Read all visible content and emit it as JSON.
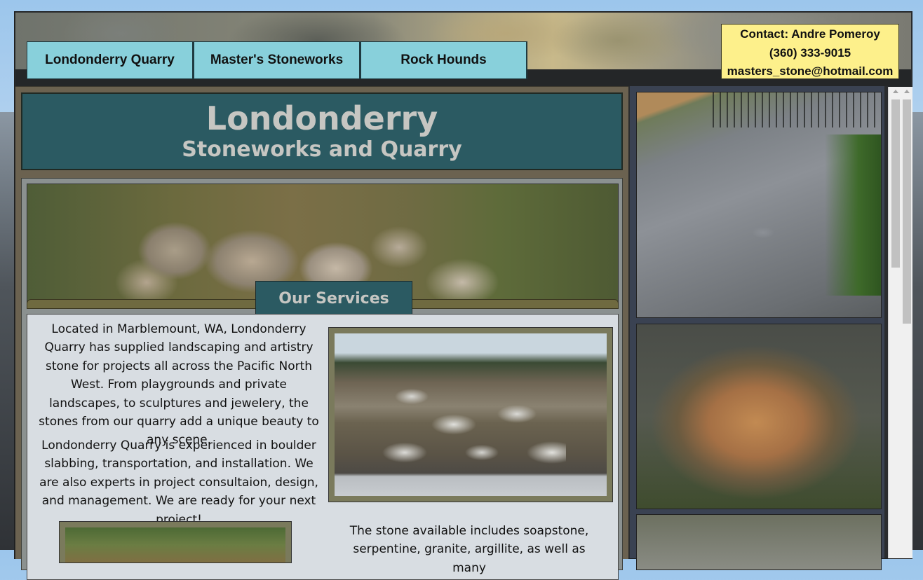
{
  "nav": {
    "items": [
      {
        "label": "Londonderry Quarry"
      },
      {
        "label": "Master's Stoneworks"
      },
      {
        "label": "Rock Hounds"
      }
    ]
  },
  "contact": {
    "line1": "Contact: Andre Pomeroy",
    "phone": "(360) 333-9015",
    "email": "masters_stone@hotmail.com"
  },
  "header": {
    "title": "Londonderry",
    "subtitle": "Stoneworks and Quarry"
  },
  "services": {
    "tab_label": "Our Services",
    "p1": "Located in Marblemount, WA, Londonderry Quarry has supplied landscaping and artistry stone for projects all across the Pacific North West. From playgrounds and private landscapes, to sculptures and jewelery, the stones from our quarry add a unique beauty to any scene.",
    "p2": "Londonderry Quarry is experienced in boulder slabbing, transportation, and installation. We are also experts in project consultaion, design, and management. We are ready for your next project!",
    "p3": "The stone available includes soapstone, serpentine, granite, argillite, as well as many"
  },
  "colors": {
    "nav_button": "#88d0db",
    "contact_bg": "#fdf08b",
    "title_bg": "#2b5a62",
    "title_text": "#c6c6c2",
    "panel_bg": "#d8dde2"
  }
}
